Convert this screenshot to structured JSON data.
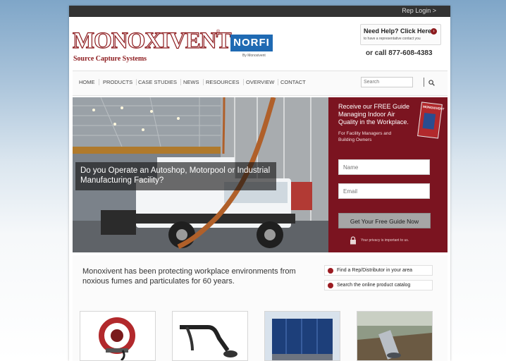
{
  "topbar": {
    "rep_login": "Rep Login >"
  },
  "brand": {
    "logo_text": "MONOXIVENT",
    "registered": "®",
    "tagline": "Source Capture Systems",
    "norfi_logo": "NORFI",
    "norfi_sub": "By Monoxivent"
  },
  "help": {
    "title": "Need Help? Click Here",
    "subtitle": "to have a representative contact you",
    "phone_line": "or call 877-608-4383",
    "icon": "arrow-right-circle-icon"
  },
  "nav": {
    "items": [
      "HOME",
      "PRODUCTS",
      "CASE STUDIES",
      "NEWS",
      "RESOURCES",
      "OVERVIEW",
      "CONTACT"
    ],
    "search_placeholder": "Search",
    "search_icon": "search-icon"
  },
  "hero": {
    "caption": "Do you Operate an Autoshop, Motorpool or Industrial Manufacturing Facility?",
    "panel": {
      "title": "Receive our FREE Guide Managing Indoor Air Quality in the Workplace.",
      "subtitle": "For Facility Managers and Building Owners",
      "cover_title": "MONOXIVENT",
      "name_placeholder": "Name",
      "email_placeholder": "Email",
      "cta_label": "Get Your Free Guide Now",
      "privacy": "Your privacy is important to us.",
      "lock_icon": "lock-icon"
    }
  },
  "intro": {
    "text": "Monoxivent has been protecting workplace environments from noxious fumes and particulates for 60 years."
  },
  "quick_links": [
    {
      "label": "Find a Rep/Distributor in your area"
    },
    {
      "label": "Search the online product catalog"
    }
  ],
  "thumbnails": [
    {
      "name": "hose-reel-product"
    },
    {
      "name": "fume-extraction-arm-product"
    },
    {
      "name": "dust-collector-product"
    },
    {
      "name": "underground-duct-product"
    }
  ],
  "colors": {
    "brand_red": "#8c1a1d",
    "panel_red": "#7b1420",
    "norfi_blue": "#1f6ab3",
    "topbar": "#333333"
  }
}
